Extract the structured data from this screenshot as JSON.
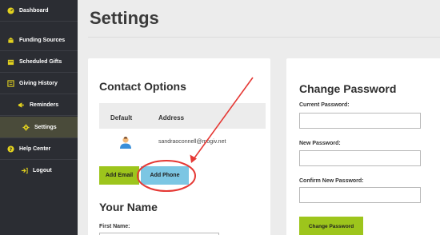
{
  "sidebar": {
    "items": [
      {
        "label": "Dashboard",
        "icon": "dashboard-icon"
      },
      {
        "label": "Funding Sources",
        "icon": "bank-icon"
      },
      {
        "label": "Scheduled Gifts",
        "icon": "calendar-icon"
      },
      {
        "label": "Giving History",
        "icon": "history-icon"
      },
      {
        "label": "Reminders",
        "icon": "megaphone-icon"
      },
      {
        "label": "Settings",
        "icon": "gear-icon",
        "active": true
      },
      {
        "label": "Help Center",
        "icon": "help-icon"
      },
      {
        "label": "Logout",
        "icon": "logout-icon"
      }
    ]
  },
  "page": {
    "title": "Settings"
  },
  "contact": {
    "title": "Contact Options",
    "columns": {
      "default": "Default",
      "address": "Address"
    },
    "rows": [
      {
        "address": "sandraoconnell@mogiv.net"
      }
    ],
    "add_email": "Add Email",
    "add_phone": "Add Phone"
  },
  "name_section": {
    "title": "Your Name",
    "first_name_label": "First Name:"
  },
  "password": {
    "title": "Change Password",
    "current_label": "Current Password:",
    "new_label": "New Password:",
    "confirm_label": "Confirm New Password:",
    "submit": "Change Password"
  },
  "colors": {
    "sidebar_bg": "#2b2d33",
    "accent_yellow": "#e3d21e",
    "green_button": "#9dc51c",
    "blue_button": "#7cc6e3",
    "annotation_red": "#e53935"
  }
}
